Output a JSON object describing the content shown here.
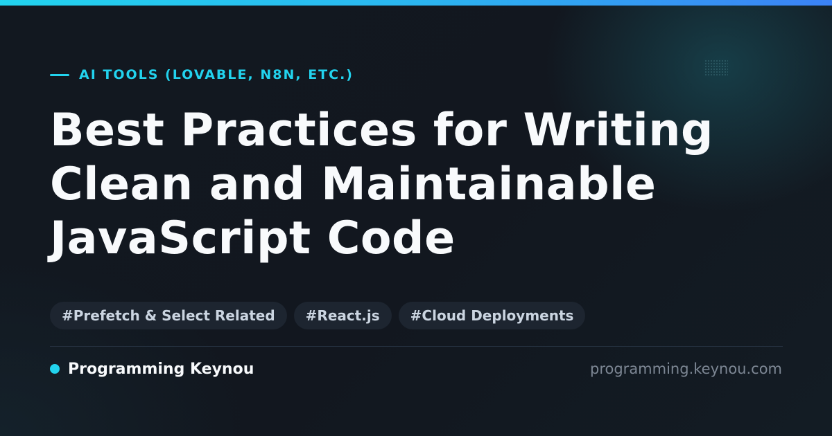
{
  "category": {
    "label": "AI TOOLS (LOVABLE, N8N, ETC.)"
  },
  "title": {
    "lines": [
      "Best Practices for Writing",
      "Clean and Maintainable",
      "JavaScript Code"
    ]
  },
  "tags": [
    "#Prefetch & Select Related",
    "#React.js",
    "#Cloud Deployments"
  ],
  "footer": {
    "brand": "Programming Keynou",
    "url": "programming.keynou.com"
  },
  "colors": {
    "accent": "#22d3ee",
    "accent_secondary": "#3b82f6",
    "background": "#11161e",
    "tag_background": "#1d2530",
    "title_text": "#f8fafc",
    "muted_text": "#7d8794"
  }
}
